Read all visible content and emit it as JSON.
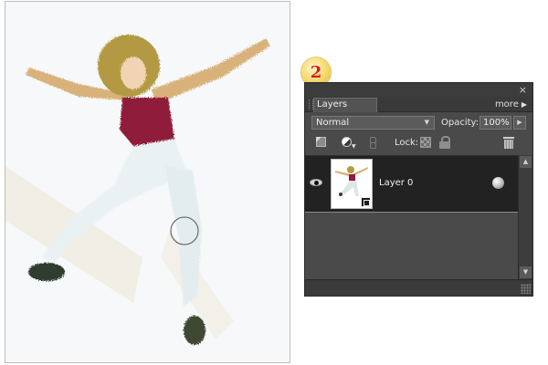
{
  "step_badge": "2",
  "layers_panel": {
    "close_glyph": "×",
    "tab_label": "Layers",
    "more_label": "more",
    "more_arrow": "▶",
    "blend_mode": "Normal",
    "opacity_label": "Opacity:",
    "opacity_value": "100%",
    "lock_label": "Lock:",
    "layers": [
      {
        "name": "Layer 0",
        "visible": true
      }
    ],
    "icons": {
      "close": "close-icon",
      "new_layer": "new-layer-icon",
      "adjustment": "adjustment-layer-icon",
      "link": "link-layers-icon",
      "lock_transparency": "lock-transparency-icon",
      "lock_all": "lock-all-icon",
      "trash": "trash-icon",
      "visibility": "eye-icon",
      "layer_style": "layer-style-icon"
    }
  },
  "colors": {
    "panel_bg": "#4a4a4a",
    "selected_row": "#222222",
    "badge_number": "#d41e1e",
    "badge_fill": "#f6d66a"
  }
}
